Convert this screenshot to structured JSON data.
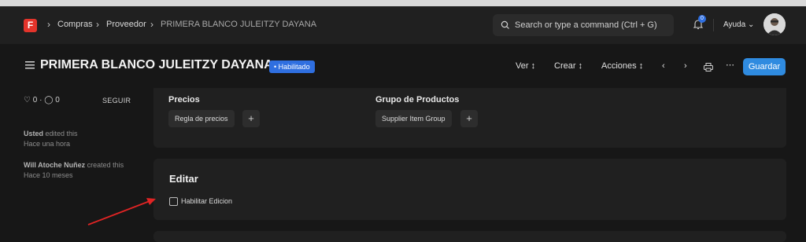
{
  "navbar": {
    "logo_letter": "F",
    "breadcrumbs": [
      "Compras",
      "Proveedor",
      "PRIMERA BLANCO JULEITZY DAYANA"
    ],
    "search_placeholder": "Search or type a command (Ctrl + G)",
    "notification_count": "0",
    "help_label": "Ayuda"
  },
  "page": {
    "title": "PRIMERA BLANCO JULEITZY DAYANA",
    "status": "• Habilitado",
    "toolbar": {
      "view": "Ver",
      "create": "Crear",
      "actions": "Acciones",
      "save": "Guardar"
    }
  },
  "sidebar": {
    "likes": "0",
    "comments": "0",
    "follow": "SEGUIR",
    "activity": [
      {
        "user": "Usted",
        "action": "edited this",
        "time": "Hace una hora"
      },
      {
        "user": "Will Atoche Nuñez",
        "action": "created this",
        "time": "Hace 10 meses"
      }
    ]
  },
  "pricing_card": {
    "prices_label": "Precios",
    "prices_value": "Regla de precios",
    "group_label": "Grupo de Productos",
    "group_value": "Supplier Item Group"
  },
  "edit_card": {
    "heading": "Editar",
    "checkbox_label": "Habilitar Edicion",
    "checked": false
  },
  "colors": {
    "accent": "#2f8be0",
    "status_badge": "#2f6fe0",
    "brand_red": "#e4342b",
    "annotation_arrow": "#e02424"
  }
}
